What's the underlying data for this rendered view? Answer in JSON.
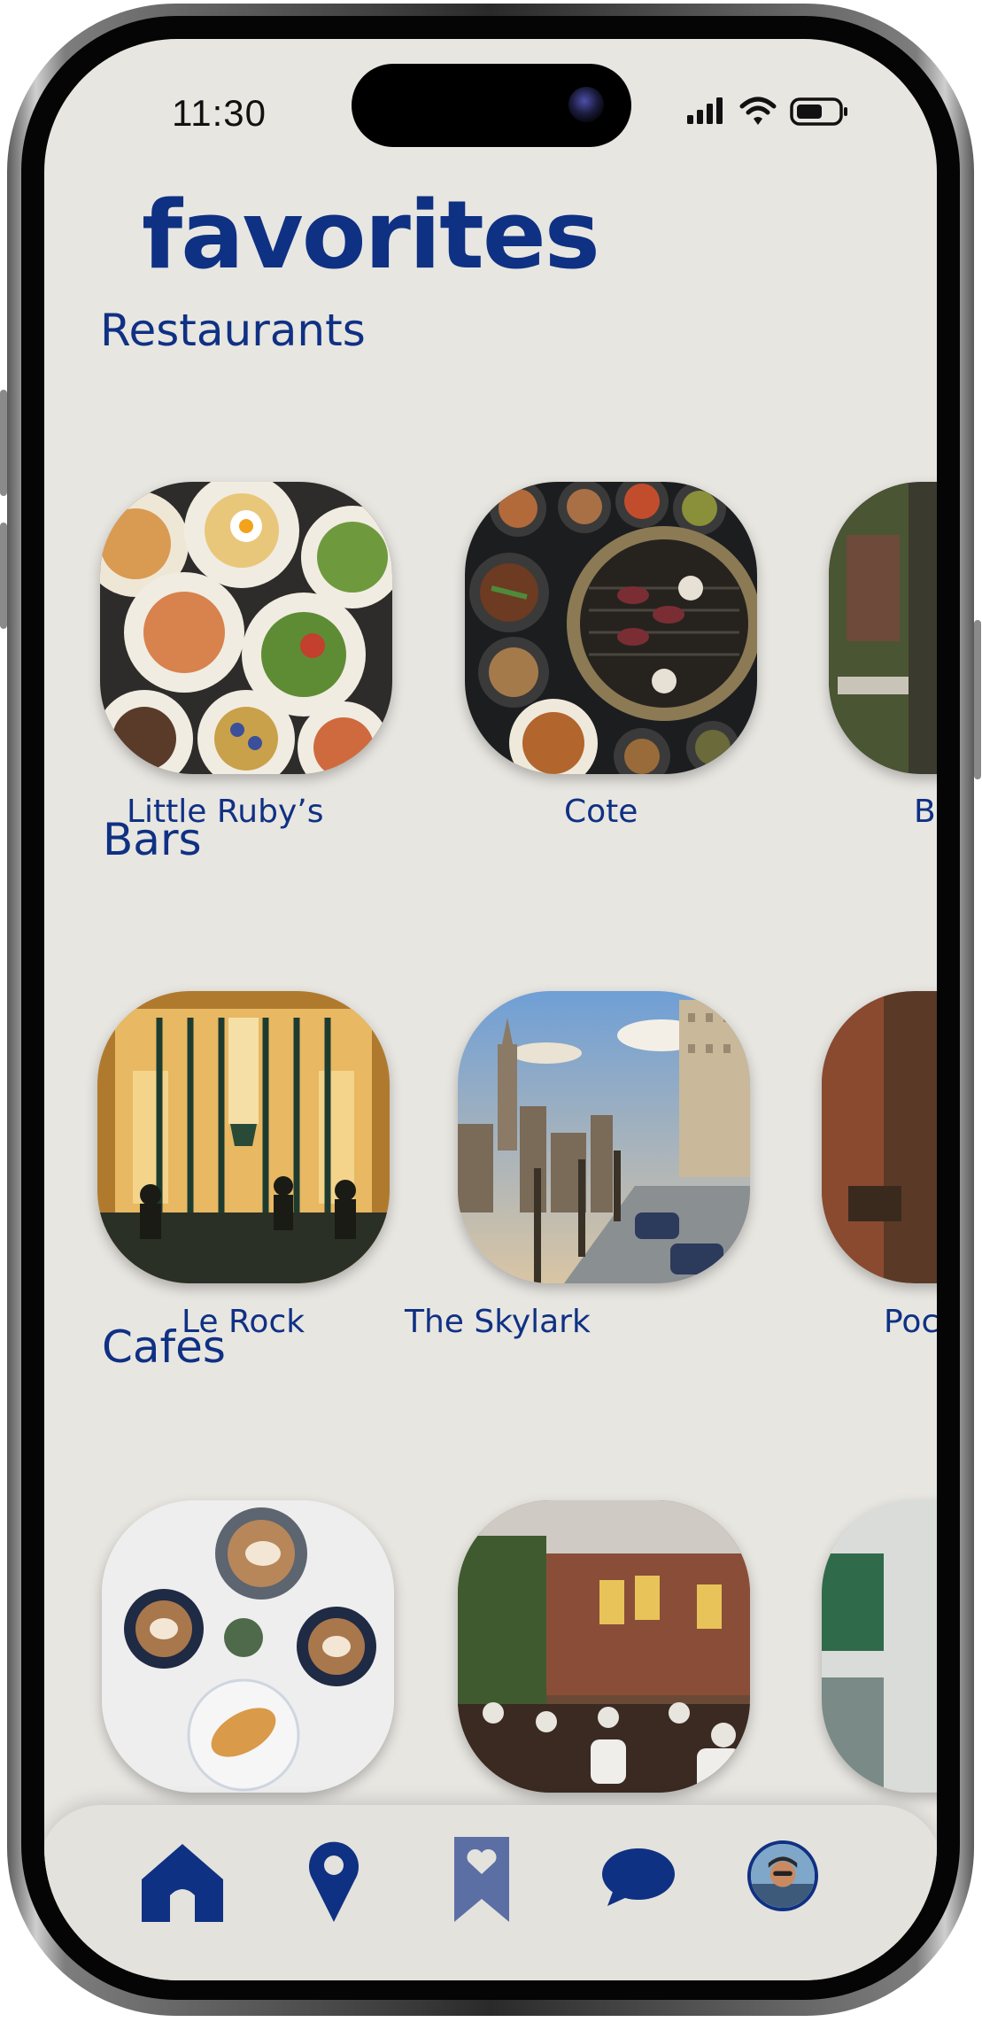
{
  "status_bar": {
    "time": "11:30"
  },
  "page": {
    "title": "favorites"
  },
  "sections": [
    {
      "label": "Restaurants",
      "items": [
        "Little Ruby’s",
        "Cote",
        "B"
      ]
    },
    {
      "label": "Bars",
      "items": [
        "Le Rock",
        "The Skylark",
        "Poc"
      ]
    },
    {
      "label": "Cafes",
      "items": [
        "",
        "",
        ""
      ]
    }
  ],
  "nav": {
    "items": [
      "home-icon",
      "location-pin-icon",
      "bookmark-heart-icon",
      "chat-bubble-icon",
      "avatar"
    ]
  },
  "colors": {
    "accent": "#0f3184",
    "background": "#e8e6e1",
    "bookmark": "#5b6fa5"
  }
}
